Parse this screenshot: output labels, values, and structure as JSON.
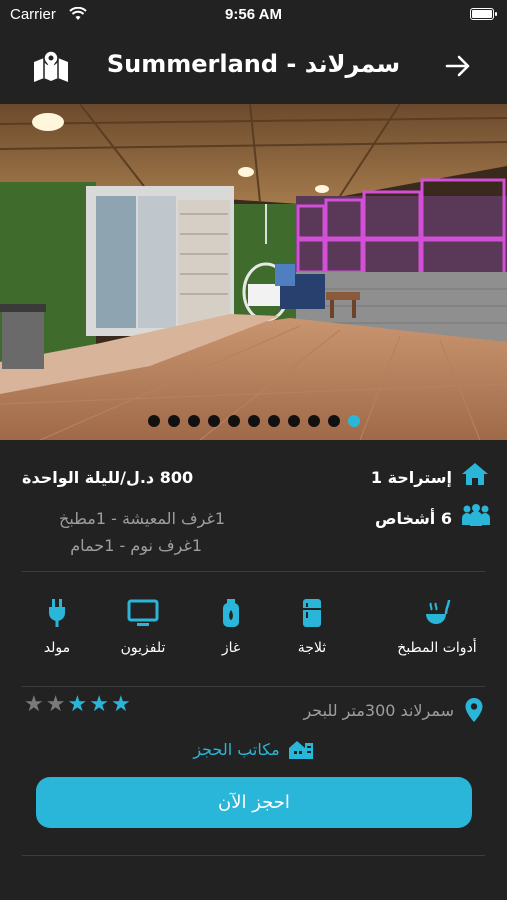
{
  "status_bar": {
    "carrier": "Carrier",
    "time": "9:56 AM"
  },
  "nav": {
    "title": "Summerland - سمرلاند",
    "map_icon": "map-icon",
    "back_icon": "arrow-right-icon"
  },
  "gallery": {
    "image_count": 11,
    "active_index": 10
  },
  "info": {
    "price": "800 د.ل/لليلة الواحدة",
    "type": "إستراحة 1",
    "capacity": "6 أشخاص",
    "rooms_line1": "1غرف المعيشة - 1مطبخ",
    "rooms_line2": "1غرف نوم - 1حمام"
  },
  "amenities": [
    {
      "label": "أدوات المطبخ",
      "icon": "kitchen-tools-icon"
    },
    {
      "label": "ثلاجة",
      "icon": "fridge-icon"
    },
    {
      "label": "غاز",
      "icon": "gas-icon"
    },
    {
      "label": "تلفزيون",
      "icon": "tv-icon"
    },
    {
      "label": "مولد",
      "icon": "generator-plug-icon"
    }
  ],
  "location": {
    "text": "سمرلاند 300متر للبحر",
    "icon": "location-pin-icon"
  },
  "rating": {
    "value": 3,
    "max": 5
  },
  "booking_offices": {
    "label": "مكاتب الحجز",
    "icon": "office-building-icon"
  },
  "book_button": {
    "label": "احجز الآن"
  },
  "colors": {
    "accent": "#29b6d8",
    "background": "#222222",
    "star_off": "#7a7a7a"
  }
}
